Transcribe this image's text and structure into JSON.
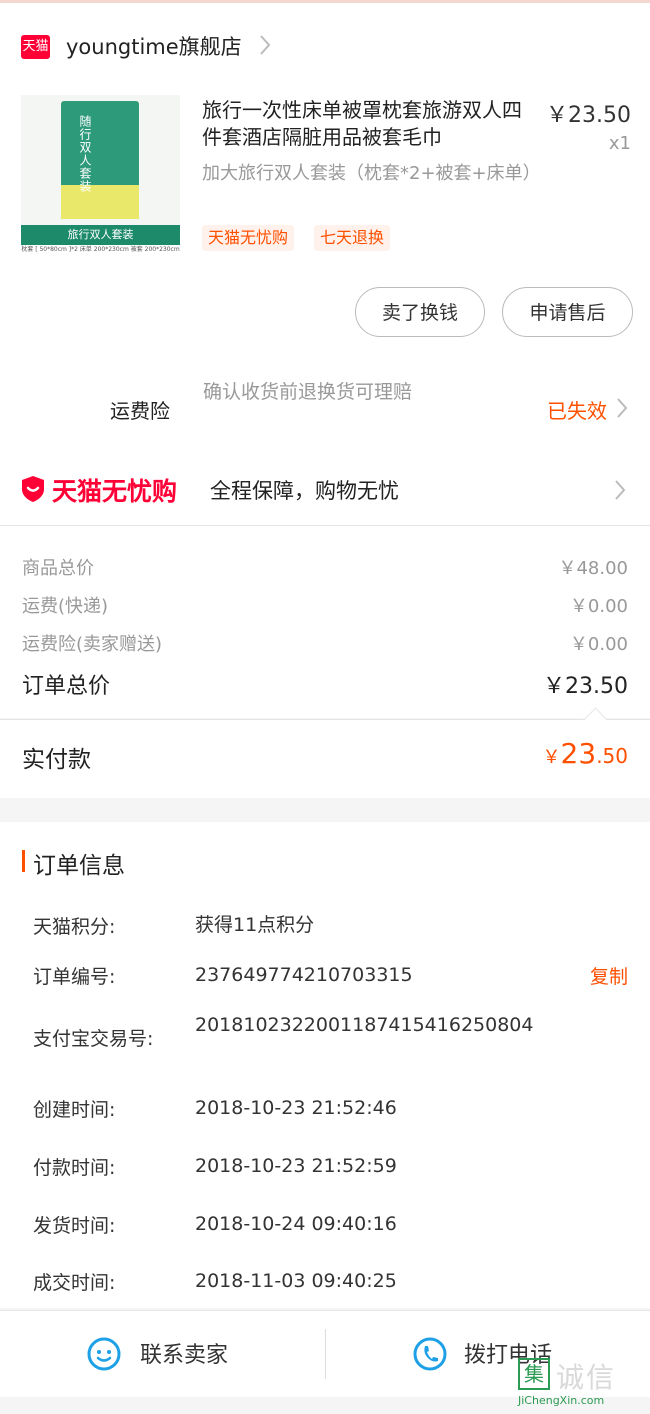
{
  "store": {
    "logo_text": "天猫",
    "name": "youngtime旗舰店"
  },
  "product": {
    "title": "旅行一次性床单被罩枕套旅游双人四件套酒店隔脏用品被套毛巾",
    "price": "￥23.50",
    "qty": "x1",
    "sku": "加大旅行双人套装（枕套*2+被套+床单）",
    "tags": [
      "天猫无忧购",
      "七天退换"
    ],
    "image": {
      "bag_text": "随行双人套装",
      "label": "旅行双人套装",
      "spec": "枕套 [ 50*80cm ]*2 床单 200*230cm 被套 200*230cm"
    }
  },
  "actions": {
    "sell": "卖了换钱",
    "after_sale": "申请售后"
  },
  "freight_insurance": {
    "label": "运费险",
    "desc": "确认收货前退换货可理赔",
    "status": "已失效"
  },
  "worry_free": {
    "brand": "天猫无忧购",
    "text": "全程保障，购物无忧"
  },
  "totals": {
    "goods_label": "商品总价",
    "goods_value": "￥48.00",
    "shipping_label": "运费(快递)",
    "shipping_value": "￥0.00",
    "insurance_label": "运费险(卖家赠送)",
    "insurance_value": "￥0.00",
    "order_total_label": "订单总价",
    "order_total_value": "￥23.50",
    "paid_label": "实付款",
    "paid_symbol": "￥",
    "paid_int": "23",
    "paid_dec": ".50"
  },
  "order_info": {
    "title": "订单信息",
    "rows": [
      {
        "key": "天猫积分:",
        "value": "获得11点积分"
      },
      {
        "key": "订单编号:",
        "value": "237649774210703315",
        "action": "复制"
      },
      {
        "key": "支付宝交易号:",
        "value": "2018102322001187415416250804"
      },
      {
        "key": "创建时间:",
        "value": "2018-10-23 21:52:46"
      },
      {
        "key": "付款时间:",
        "value": "2018-10-23 21:52:59"
      },
      {
        "key": "发货时间:",
        "value": "2018-10-24 09:40:16"
      },
      {
        "key": "成交时间:",
        "value": "2018-11-03 09:40:25"
      }
    ]
  },
  "bottom_bar": {
    "contact": "联系卖家",
    "call": "拨打电话"
  },
  "watermark": {
    "box": "集",
    "cn": "诚信",
    "en": "JiChengXin.com"
  },
  "colors": {
    "accent": "#ff5000",
    "tmall_red": "#ff0036",
    "icon_blue": "#1ea0e6"
  }
}
